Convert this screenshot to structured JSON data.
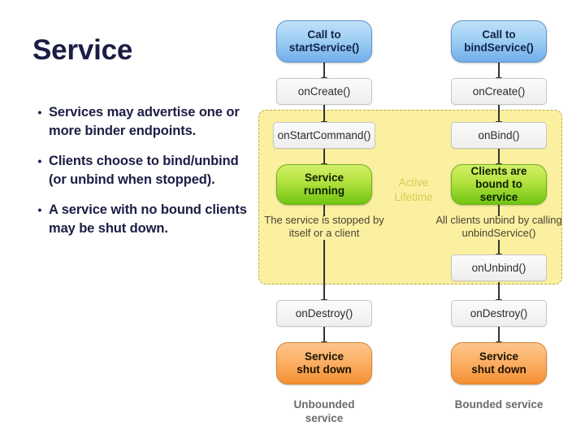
{
  "slide": {
    "title": "Service",
    "bullets": [
      {
        "marker": "•",
        "text": "Services may advertise one or more binder endpoints."
      },
      {
        "marker": "•",
        "text": "Clients choose to bind/unbind (or unbind when stopped)."
      },
      {
        "marker": "•",
        "text": "A service with no bound clients may be shut down."
      }
    ]
  },
  "diagram": {
    "lifetime_label": "Active\nLifetime",
    "lifetime_label_line1": "Active",
    "lifetime_label_line2": "Lifetime",
    "unbounded": {
      "start_line1": "Call to",
      "start_line2": "startService()",
      "on_create": "onCreate()",
      "on_start_command": "onStartCommand()",
      "running_line1": "Service",
      "running_line2": "running",
      "caption_line1": "The service is stopped",
      "caption_line2": "by itself or a client",
      "on_destroy": "onDestroy()",
      "shutdown_line1": "Service",
      "shutdown_line2": "shut down",
      "foot_line1": "Unbounded",
      "foot_line2": "service"
    },
    "bounded": {
      "start_line1": "Call to",
      "start_line2": "bindService()",
      "on_create": "onCreate()",
      "on_bind": "onBind()",
      "bound_line1": "Clients are",
      "bound_line2": "bound to",
      "bound_line3": "service",
      "caption_line1": "All clients unbind by calling",
      "caption_line2": "unbindService()",
      "on_unbind": "onUnbind()",
      "on_destroy": "onDestroy()",
      "shutdown_line1": "Service",
      "shutdown_line2": "shut down",
      "foot_line1": "Bounded",
      "foot_line2": "service"
    }
  },
  "colors": {
    "title_navy": "#1b1d45",
    "lifetime_fill": "#faf0a0",
    "lifetime_border": "#b9ac52",
    "lifetime_text": "#d8cc52",
    "blue_pill": "#9fd0f4",
    "green_pill": "#b6e441",
    "orange_pill": "#fbb167",
    "callback_fill": "#f1f1f1",
    "arrow": "#333333"
  }
}
